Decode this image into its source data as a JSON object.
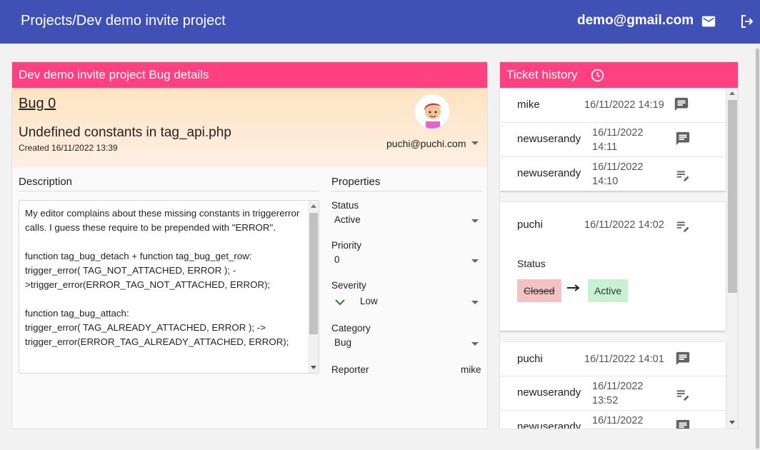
{
  "topbar": {
    "breadcrumb": "Projects/Dev demo invite project",
    "user_email": "demo@gmail.com",
    "mail_icon": "mail-icon",
    "logout_icon": "logout-icon"
  },
  "bug_card": {
    "header": "Dev demo invite project Bug details",
    "bug_link": "Bug 0",
    "title": "Undefined constants in tag_api.php",
    "created": "Created 16/11/2022 13:39",
    "assignee": "puchi@puchi.com",
    "description_heading": "Description",
    "description": "My editor complains about these missing constants in triggererror calls. I guess these require to be prepended with \"ERROR\".\n\nfunction tag_bug_detach + function tag_bug_get_row:\ntrigger_error( TAG_NOT_ATTACHED, ERROR ); ->trigger_error(ERROR_TAG_NOT_ATTACHED, ERROR);\n\nfunction tag_bug_attach:\ntrigger_error( TAG_ALREADY_ATTACHED, ERROR ); ->\ntrigger_error(ERROR_TAG_ALREADY_ATTACHED, ERROR);",
    "properties_heading": "Properties",
    "properties": {
      "status_label": "Status",
      "status_value": "Active",
      "priority_label": "Priority",
      "priority_value": "0",
      "severity_label": "Severity",
      "severity_value": "Low",
      "category_label": "Category",
      "category_value": "Bug",
      "reporter_label": "Reporter",
      "reporter_value": "mike"
    }
  },
  "history": {
    "header": "Ticket history",
    "group1": [
      {
        "user": "mike",
        "date": "16/11/2022 14:19",
        "icon": "comment-icon"
      },
      {
        "user": "newuserandy",
        "date": "16/11/2022\n14:11",
        "icon": "comment-icon"
      },
      {
        "user": "newuserandy",
        "date": "16/11/2022\n14:10",
        "icon": "edit-note-icon"
      }
    ],
    "group2": {
      "user": "puchi",
      "date": "16/11/2022 14:02",
      "icon": "edit-note-icon",
      "field": "Status",
      "old_value": "Closed",
      "new_value": "Active"
    },
    "group3": [
      {
        "user": "puchi",
        "date": "16/11/2022 14:01",
        "icon": "comment-icon"
      },
      {
        "user": "newuserandy",
        "date": "16/11/2022\n13:52",
        "icon": "edit-note-icon"
      },
      {
        "user": "newuserandy",
        "date": "16/11/2022",
        "icon": "comment-icon"
      }
    ]
  },
  "colors": {
    "topbar": "#3f51b5",
    "accent": "#ff4081",
    "old_chip": "#f5c2c2",
    "new_chip": "#c6f2cf"
  }
}
